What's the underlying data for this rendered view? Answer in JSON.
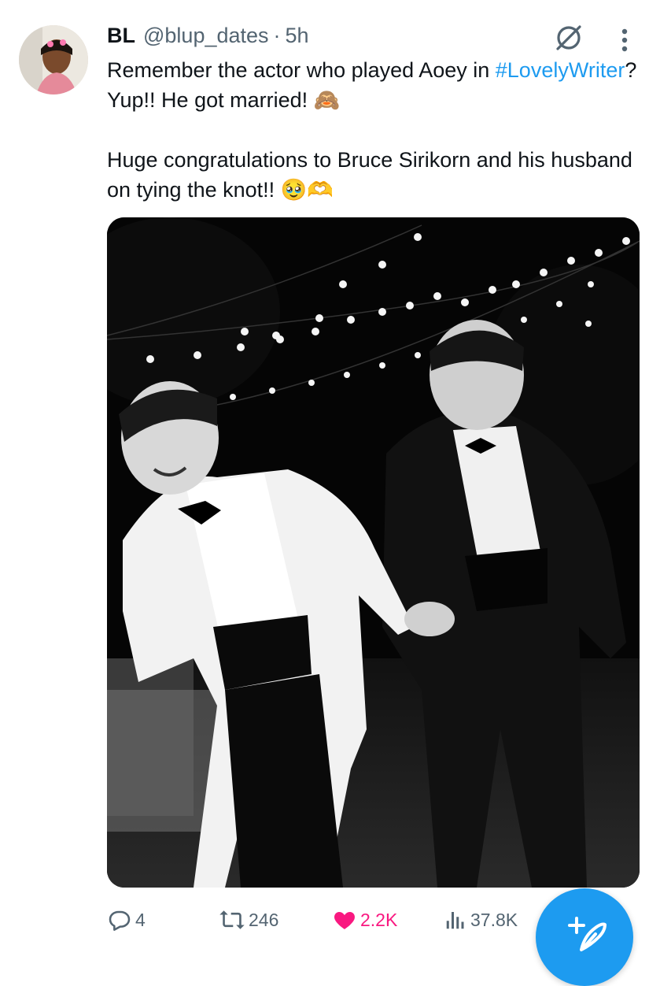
{
  "tweet": {
    "author_name": "BL",
    "author_handle": "@blup_dates",
    "separator": "·",
    "time": "5h",
    "text_line1_pre": "Remember the actor who played Aoey in ",
    "hashtag": "#LovelyWriter",
    "text_line1_post": "? Yup!! He got married! ",
    "emoji1": "🙈",
    "text_para2": "Huge congratulations to Bruce Sirikorn and his husband on tying the knot!! ",
    "emoji2": "🥹",
    "emoji3": "🫶"
  },
  "actions": {
    "replies": "4",
    "reposts": "246",
    "likes": "2.2K",
    "views": "37.8K"
  },
  "colors": {
    "accent": "#1d9bf0",
    "like": "#f91880",
    "muted": "#536471",
    "text": "#0f1419"
  },
  "icons": {
    "grok": "grok-icon",
    "more": "more-vertical-icon",
    "reply": "reply-icon",
    "repost": "repost-icon",
    "like": "heart-filled-icon",
    "views": "views-icon",
    "compose": "compose-icon"
  }
}
